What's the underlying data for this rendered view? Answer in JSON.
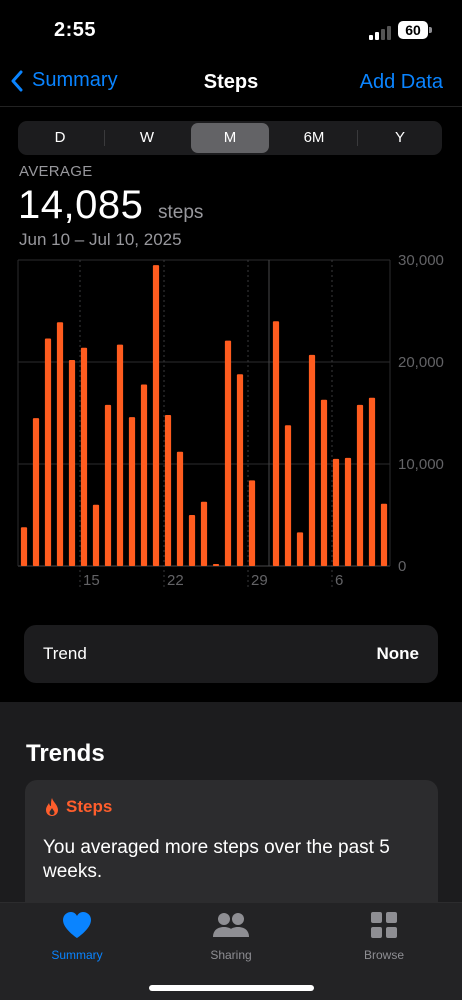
{
  "status": {
    "time": "2:55",
    "battery": "60"
  },
  "nav": {
    "back_label": "Summary",
    "title": "Steps",
    "action_label": "Add Data"
  },
  "segments": [
    "D",
    "W",
    "M",
    "6M",
    "Y"
  ],
  "selected_segment": "M",
  "summary": {
    "label": "AVERAGE",
    "value": "14,085",
    "unit": "steps",
    "date_range": "Jun 10 – Jul 10, 2025"
  },
  "chart_data": {
    "type": "bar",
    "categories": [
      "Jun 10",
      "Jun 11",
      "Jun 12",
      "Jun 13",
      "Jun 14",
      "Jun 15",
      "Jun 16",
      "Jun 17",
      "Jun 18",
      "Jun 19",
      "Jun 20",
      "Jun 21",
      "Jun 22",
      "Jun 23",
      "Jun 24",
      "Jun 25",
      "Jun 26",
      "Jun 27",
      "Jun 28",
      "Jun 29",
      "Jun 30",
      "Jul 1",
      "Jul 2",
      "Jul 3",
      "Jul 4",
      "Jul 5",
      "Jul 6",
      "Jul 7",
      "Jul 8",
      "Jul 9",
      "Jul 10"
    ],
    "values": [
      3800,
      14500,
      22300,
      23900,
      20200,
      21400,
      6000,
      15800,
      21700,
      14600,
      17800,
      29500,
      14800,
      11200,
      5000,
      6300,
      200,
      22100,
      18800,
      8400,
      0,
      24000,
      13800,
      3300,
      20700,
      16300,
      10500,
      10600,
      15800,
      16500,
      6100
    ],
    "ylim": [
      0,
      30000
    ],
    "y_ticks": [
      "30,000",
      "20,000",
      "10,000",
      "0"
    ],
    "x_ticks": [
      "15",
      "22",
      "29",
      "6"
    ],
    "color": "#ff5c1f"
  },
  "trend": {
    "label": "Trend",
    "value": "None"
  },
  "trends_section": {
    "title": "Trends",
    "card_title": "Steps",
    "card_text": "You averaged more steps over the past 5 weeks."
  },
  "tabs": [
    {
      "label": "Summary",
      "icon": "heart-icon",
      "color": "#0a84ff"
    },
    {
      "label": "Sharing",
      "icon": "people-icon",
      "color": "#8e8e93"
    },
    {
      "label": "Browse",
      "icon": "grid-icon",
      "color": "#8e8e93"
    }
  ]
}
